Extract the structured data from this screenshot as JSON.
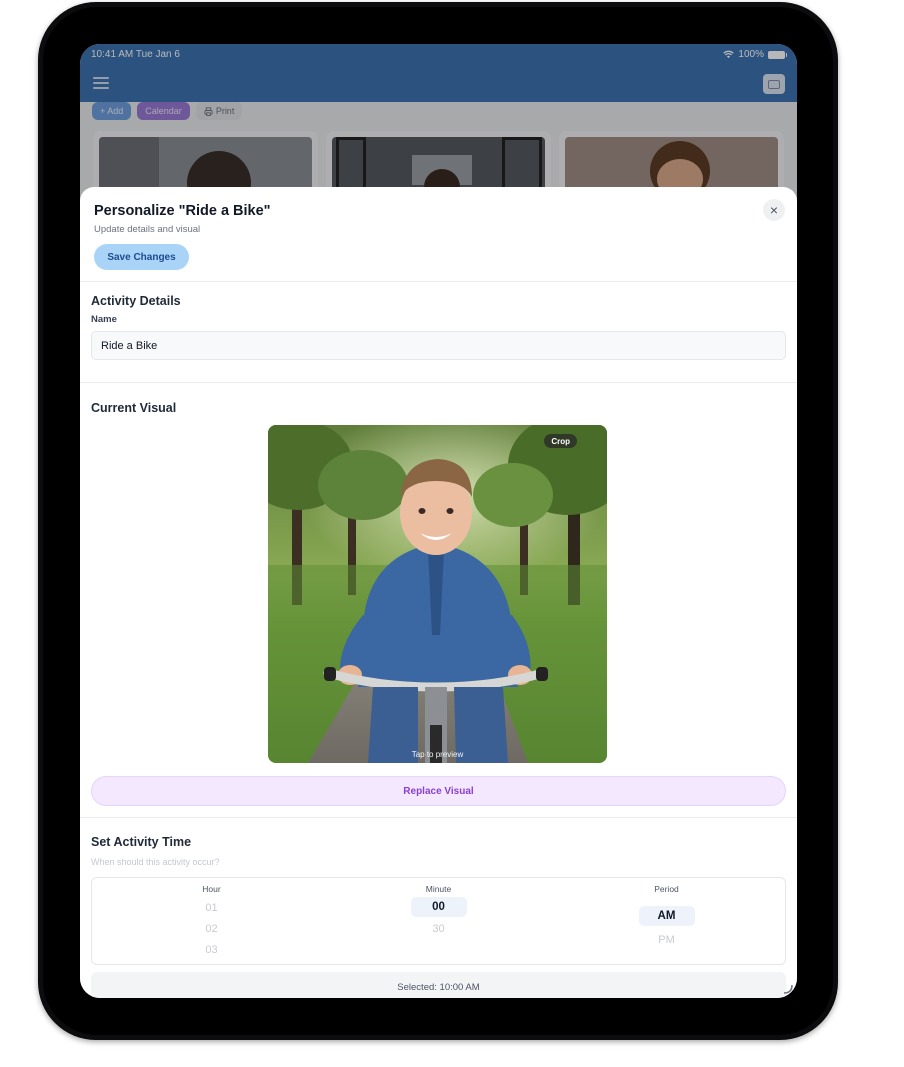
{
  "status_bar": {
    "time": "10:41 AM  Tue Jan 6",
    "battery": "100%"
  },
  "background": {
    "toolbar": {
      "add": "+ Add",
      "calendar": "Calendar",
      "print": "Print"
    }
  },
  "modal": {
    "title": "Personalize \"Ride a Bike\"",
    "subtitle": "Update details and visual",
    "save_label": "Save Changes",
    "close_icon": "×"
  },
  "details": {
    "heading": "Activity Details",
    "name_label": "Name",
    "name_value": "Ride a Bike"
  },
  "visual": {
    "heading": "Current Visual",
    "crop_label": "Crop",
    "tap_hint": "Tap to preview",
    "replace_label": "Replace Visual"
  },
  "time": {
    "heading": "Set Activity Time",
    "hint": "When should this activity occur?",
    "hour": {
      "label": "Hour",
      "options": [
        "01",
        "02",
        "03"
      ]
    },
    "minute": {
      "label": "Minute",
      "selected": "00",
      "options": [
        "30"
      ]
    },
    "period": {
      "label": "Period",
      "selected": "AM",
      "options": [
        "PM"
      ]
    },
    "selected_summary": "Selected: 10:00 AM"
  },
  "colors": {
    "header": "#3e73b2",
    "save": "#a9d4f8",
    "replace": "#f3e8fd",
    "accent_purple": "#8a3fcf"
  }
}
